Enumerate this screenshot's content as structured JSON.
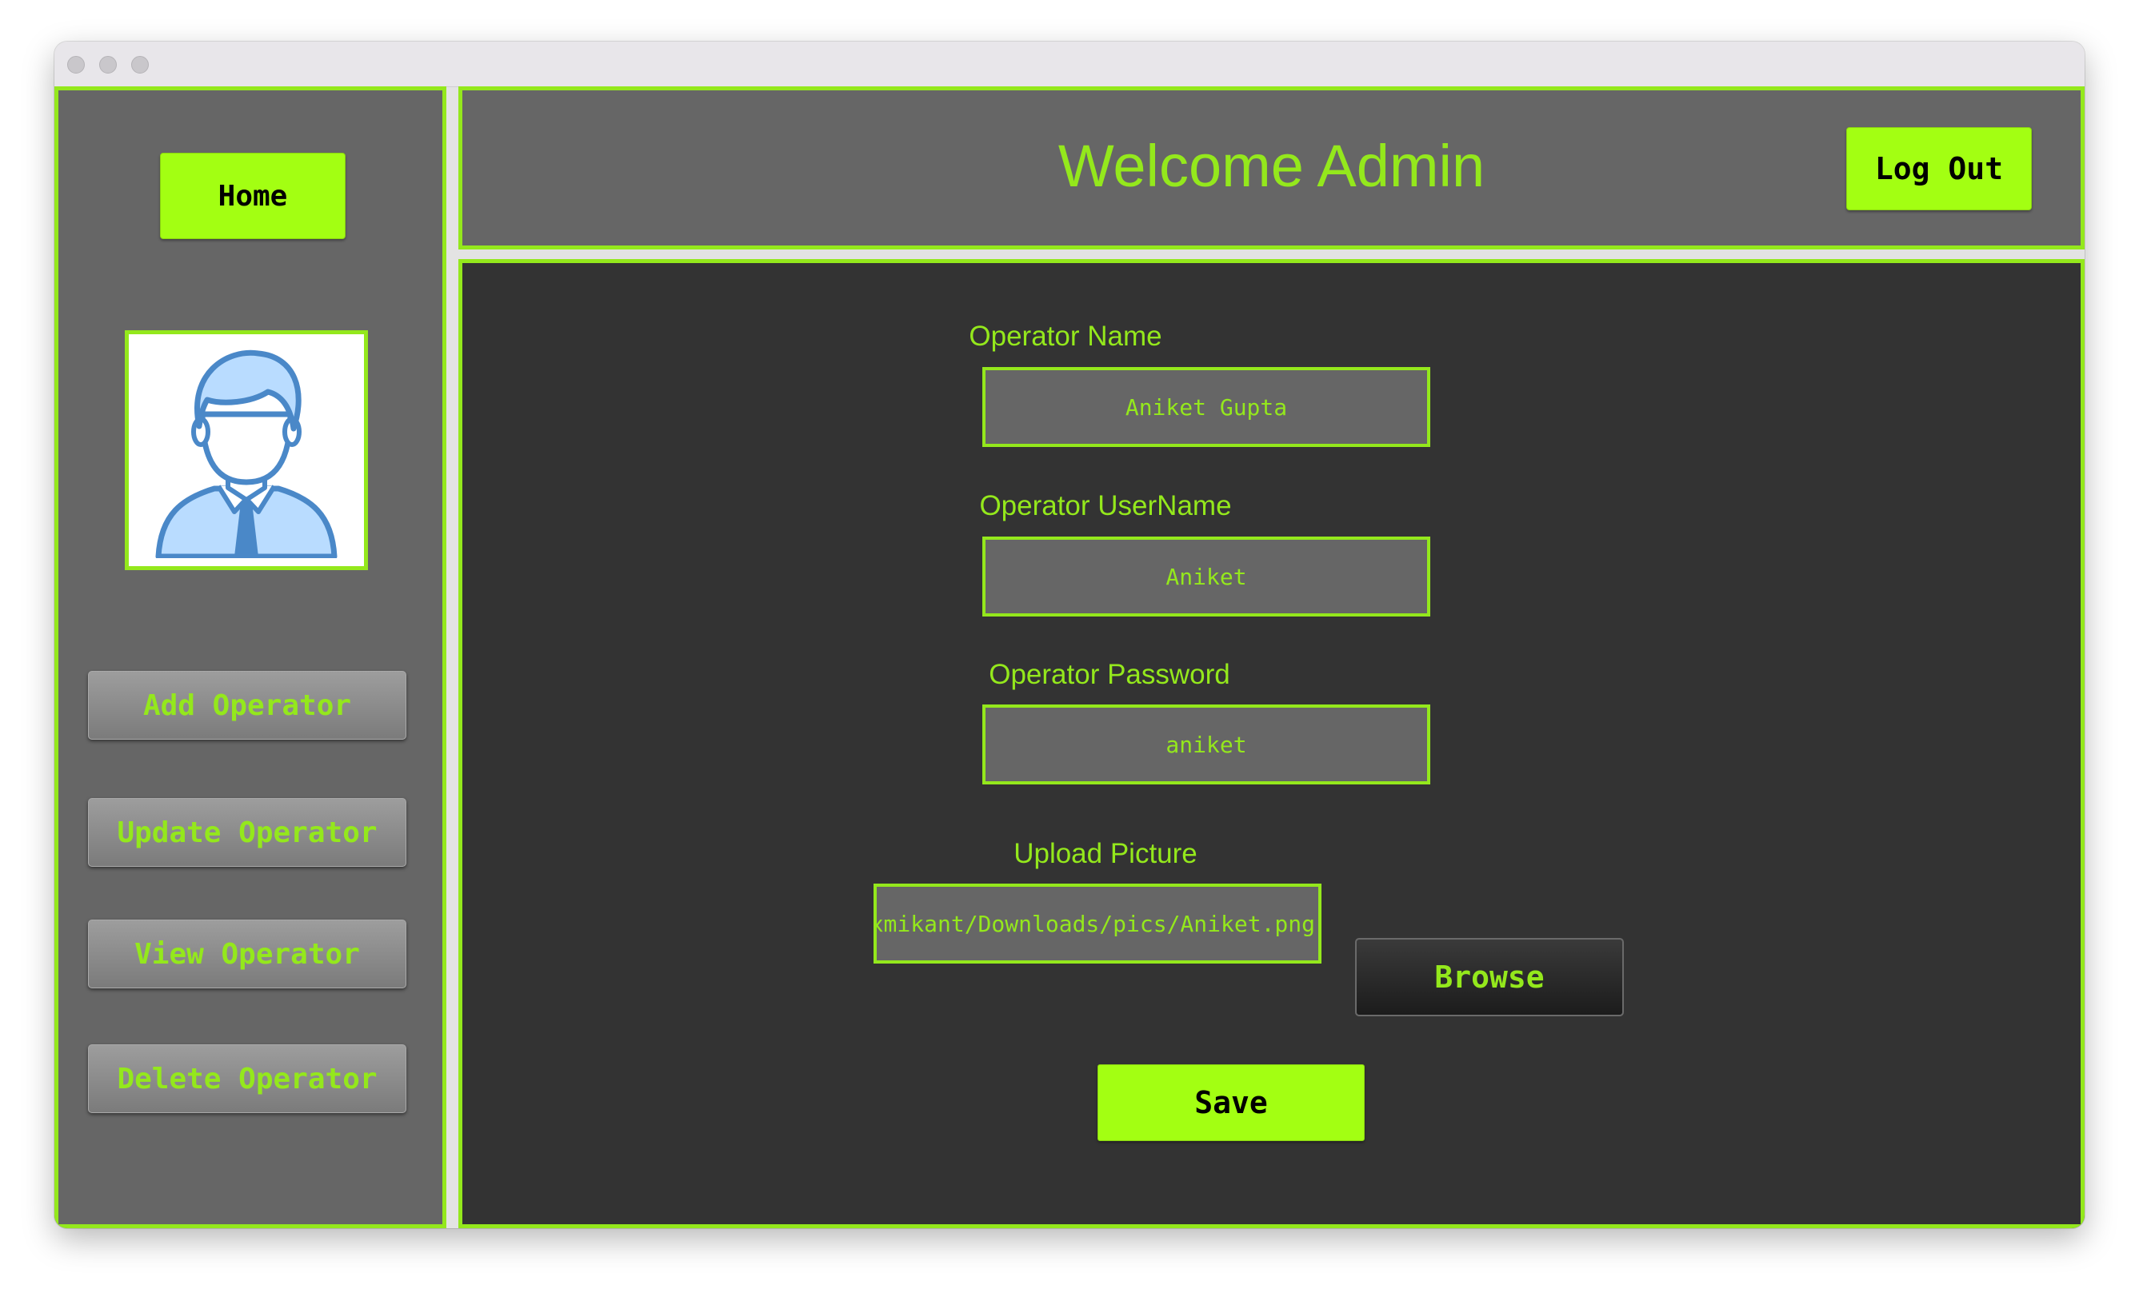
{
  "header": {
    "welcome": "Welcome Admin",
    "logout_label": "Log Out"
  },
  "sidebar": {
    "home_label": "Home",
    "avatar_icon": "user-avatar-icon",
    "items": [
      {
        "label": "Add Operator"
      },
      {
        "label": "Update Operator"
      },
      {
        "label": "View Operator"
      },
      {
        "label": "Delete Operator"
      }
    ]
  },
  "form": {
    "name_label": "Operator Name",
    "name_value": "Aniket Gupta",
    "username_label": "Operator UserName",
    "username_value": "Aniket",
    "password_label": "Operator Password",
    "password_value": "aniket",
    "upload_label": "Upload Picture",
    "upload_value": "/Users/laxmikant/Downloads/pics/Aniket.png",
    "browse_label": "Browse",
    "save_label": "Save"
  },
  "colors": {
    "accent": "#94e81c",
    "button_green": "#a3ff12",
    "panel_gray": "#666666",
    "main_bg": "#333333"
  }
}
